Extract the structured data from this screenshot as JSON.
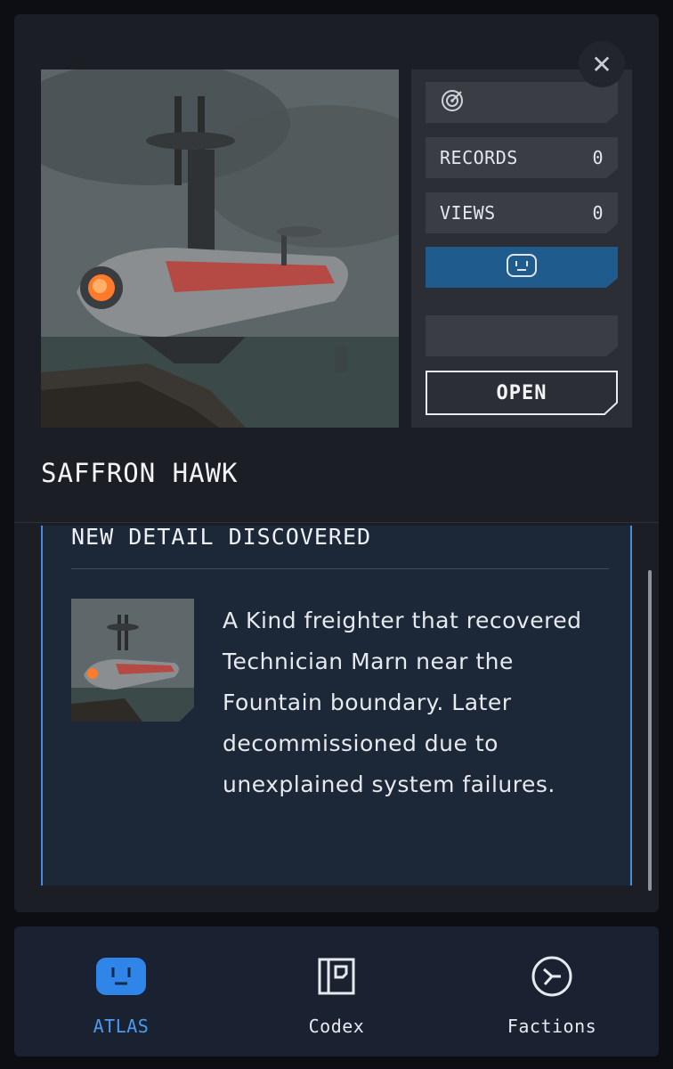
{
  "close": {
    "glyph": "✕"
  },
  "ship": {
    "name": "SAFFRON HAWK"
  },
  "stats": {
    "records_label": "RECORDS",
    "records_value": "0",
    "views_label": "VIEWS",
    "views_value": "0"
  },
  "actions": {
    "open_label": "OPEN"
  },
  "detail": {
    "heading": "NEW DETAIL DISCOVERED",
    "description": "A Kind freighter that recovered Technician Marn near the Fountain boundary. Later decommissioned due to unexplained system failures."
  },
  "nav": {
    "items": [
      {
        "label": "ATLAS",
        "icon": "atlas-face-icon",
        "active": true
      },
      {
        "label": "Codex",
        "icon": "codex-book-icon",
        "active": false
      },
      {
        "label": "Factions",
        "icon": "factions-emblem-icon",
        "active": false
      }
    ]
  },
  "colors": {
    "accent": "#1f5b8c",
    "active_nav": "#4b9af0",
    "detail_border": "#4a8be0"
  }
}
